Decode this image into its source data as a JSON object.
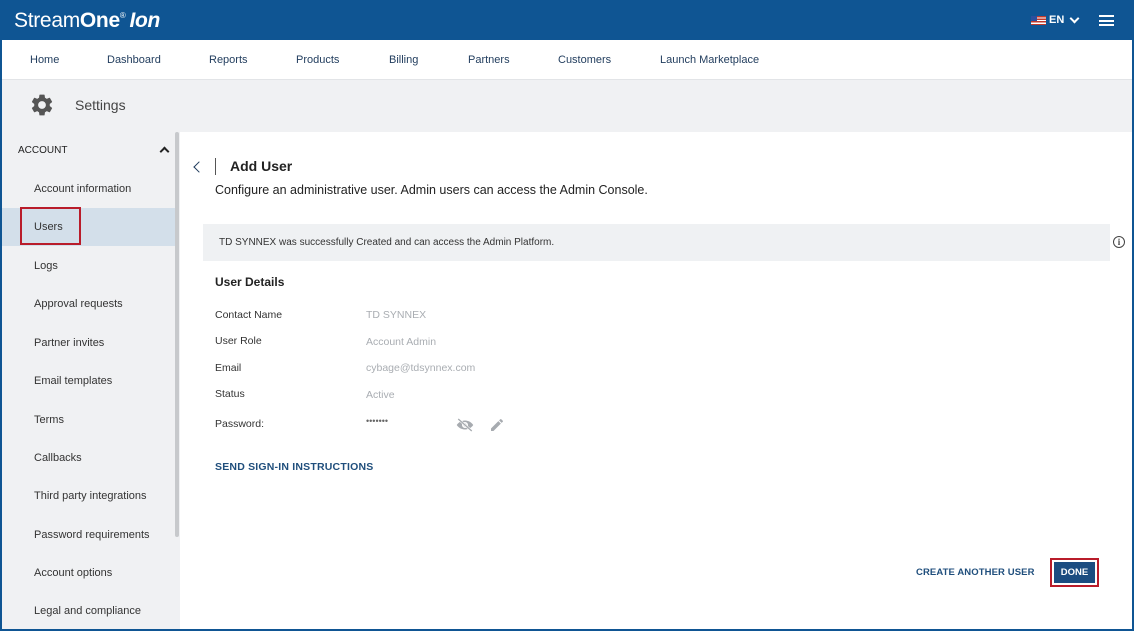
{
  "header": {
    "logo_stream": "Stream",
    "logo_one": "One",
    "logo_reg": "®",
    "logo_ion": "Ion",
    "language": "EN",
    "brand_color": "#0f5593"
  },
  "nav": {
    "items": [
      "Home",
      "Dashboard",
      "Reports",
      "Products",
      "Billing",
      "Partners",
      "Customers",
      "Launch Marketplace"
    ]
  },
  "settings": {
    "title": "Settings"
  },
  "sidebar": {
    "section": "ACCOUNT",
    "items": [
      "Account information",
      "Users",
      "Logs",
      "Approval requests",
      "Partner invites",
      "Email templates",
      "Terms",
      "Callbacks",
      "Third party integrations",
      "Password requirements",
      "Account options",
      "Legal and compliance"
    ],
    "active_item": "Users"
  },
  "main": {
    "title": "Add User",
    "subtitle": "Configure an administrative user. Admin users can access the Admin Console.",
    "notice": "TD SYNNEX was successfully Created and can access the Admin Platform.",
    "details_title": "User Details",
    "fields": [
      {
        "label": "Contact Name",
        "value": "TD SYNNEX"
      },
      {
        "label": "User Role",
        "value": "Account Admin"
      },
      {
        "label": "Email",
        "value": "cybage@tdsynnex.com"
      },
      {
        "label": "Status",
        "value": "Active"
      },
      {
        "label": "Password:",
        "value": "•••••••"
      }
    ],
    "send_instructions": "SEND SIGN-IN INSTRUCTIONS",
    "create_another": "CREATE ANOTHER USER",
    "done": "DONE"
  }
}
